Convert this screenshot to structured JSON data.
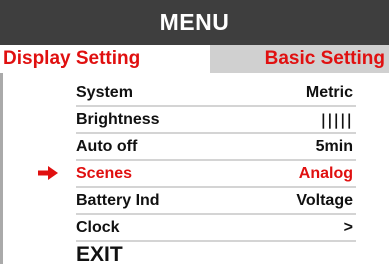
{
  "header": {
    "title": "MENU"
  },
  "tabs": [
    {
      "label": "Display Setting",
      "active": true
    },
    {
      "label": "Basic Setting",
      "active": false
    }
  ],
  "menu": {
    "items": [
      {
        "label": "System",
        "value": "Metric"
      },
      {
        "label": "Brightness",
        "value": "|||||"
      },
      {
        "label": "Auto off",
        "value": "5min"
      },
      {
        "label": "Scenes",
        "value": "Analog",
        "selected": true
      },
      {
        "label": "Battery Ind",
        "value": "Voltage"
      },
      {
        "label": "Clock",
        "value": ">"
      }
    ],
    "exit_label": "EXIT"
  },
  "colors": {
    "header_bg": "#3e3e3e",
    "accent_red": "#e01010",
    "inactive_tab_bg": "#d0d0d0"
  },
  "icons": {
    "cursor": "right-arrow-icon"
  }
}
